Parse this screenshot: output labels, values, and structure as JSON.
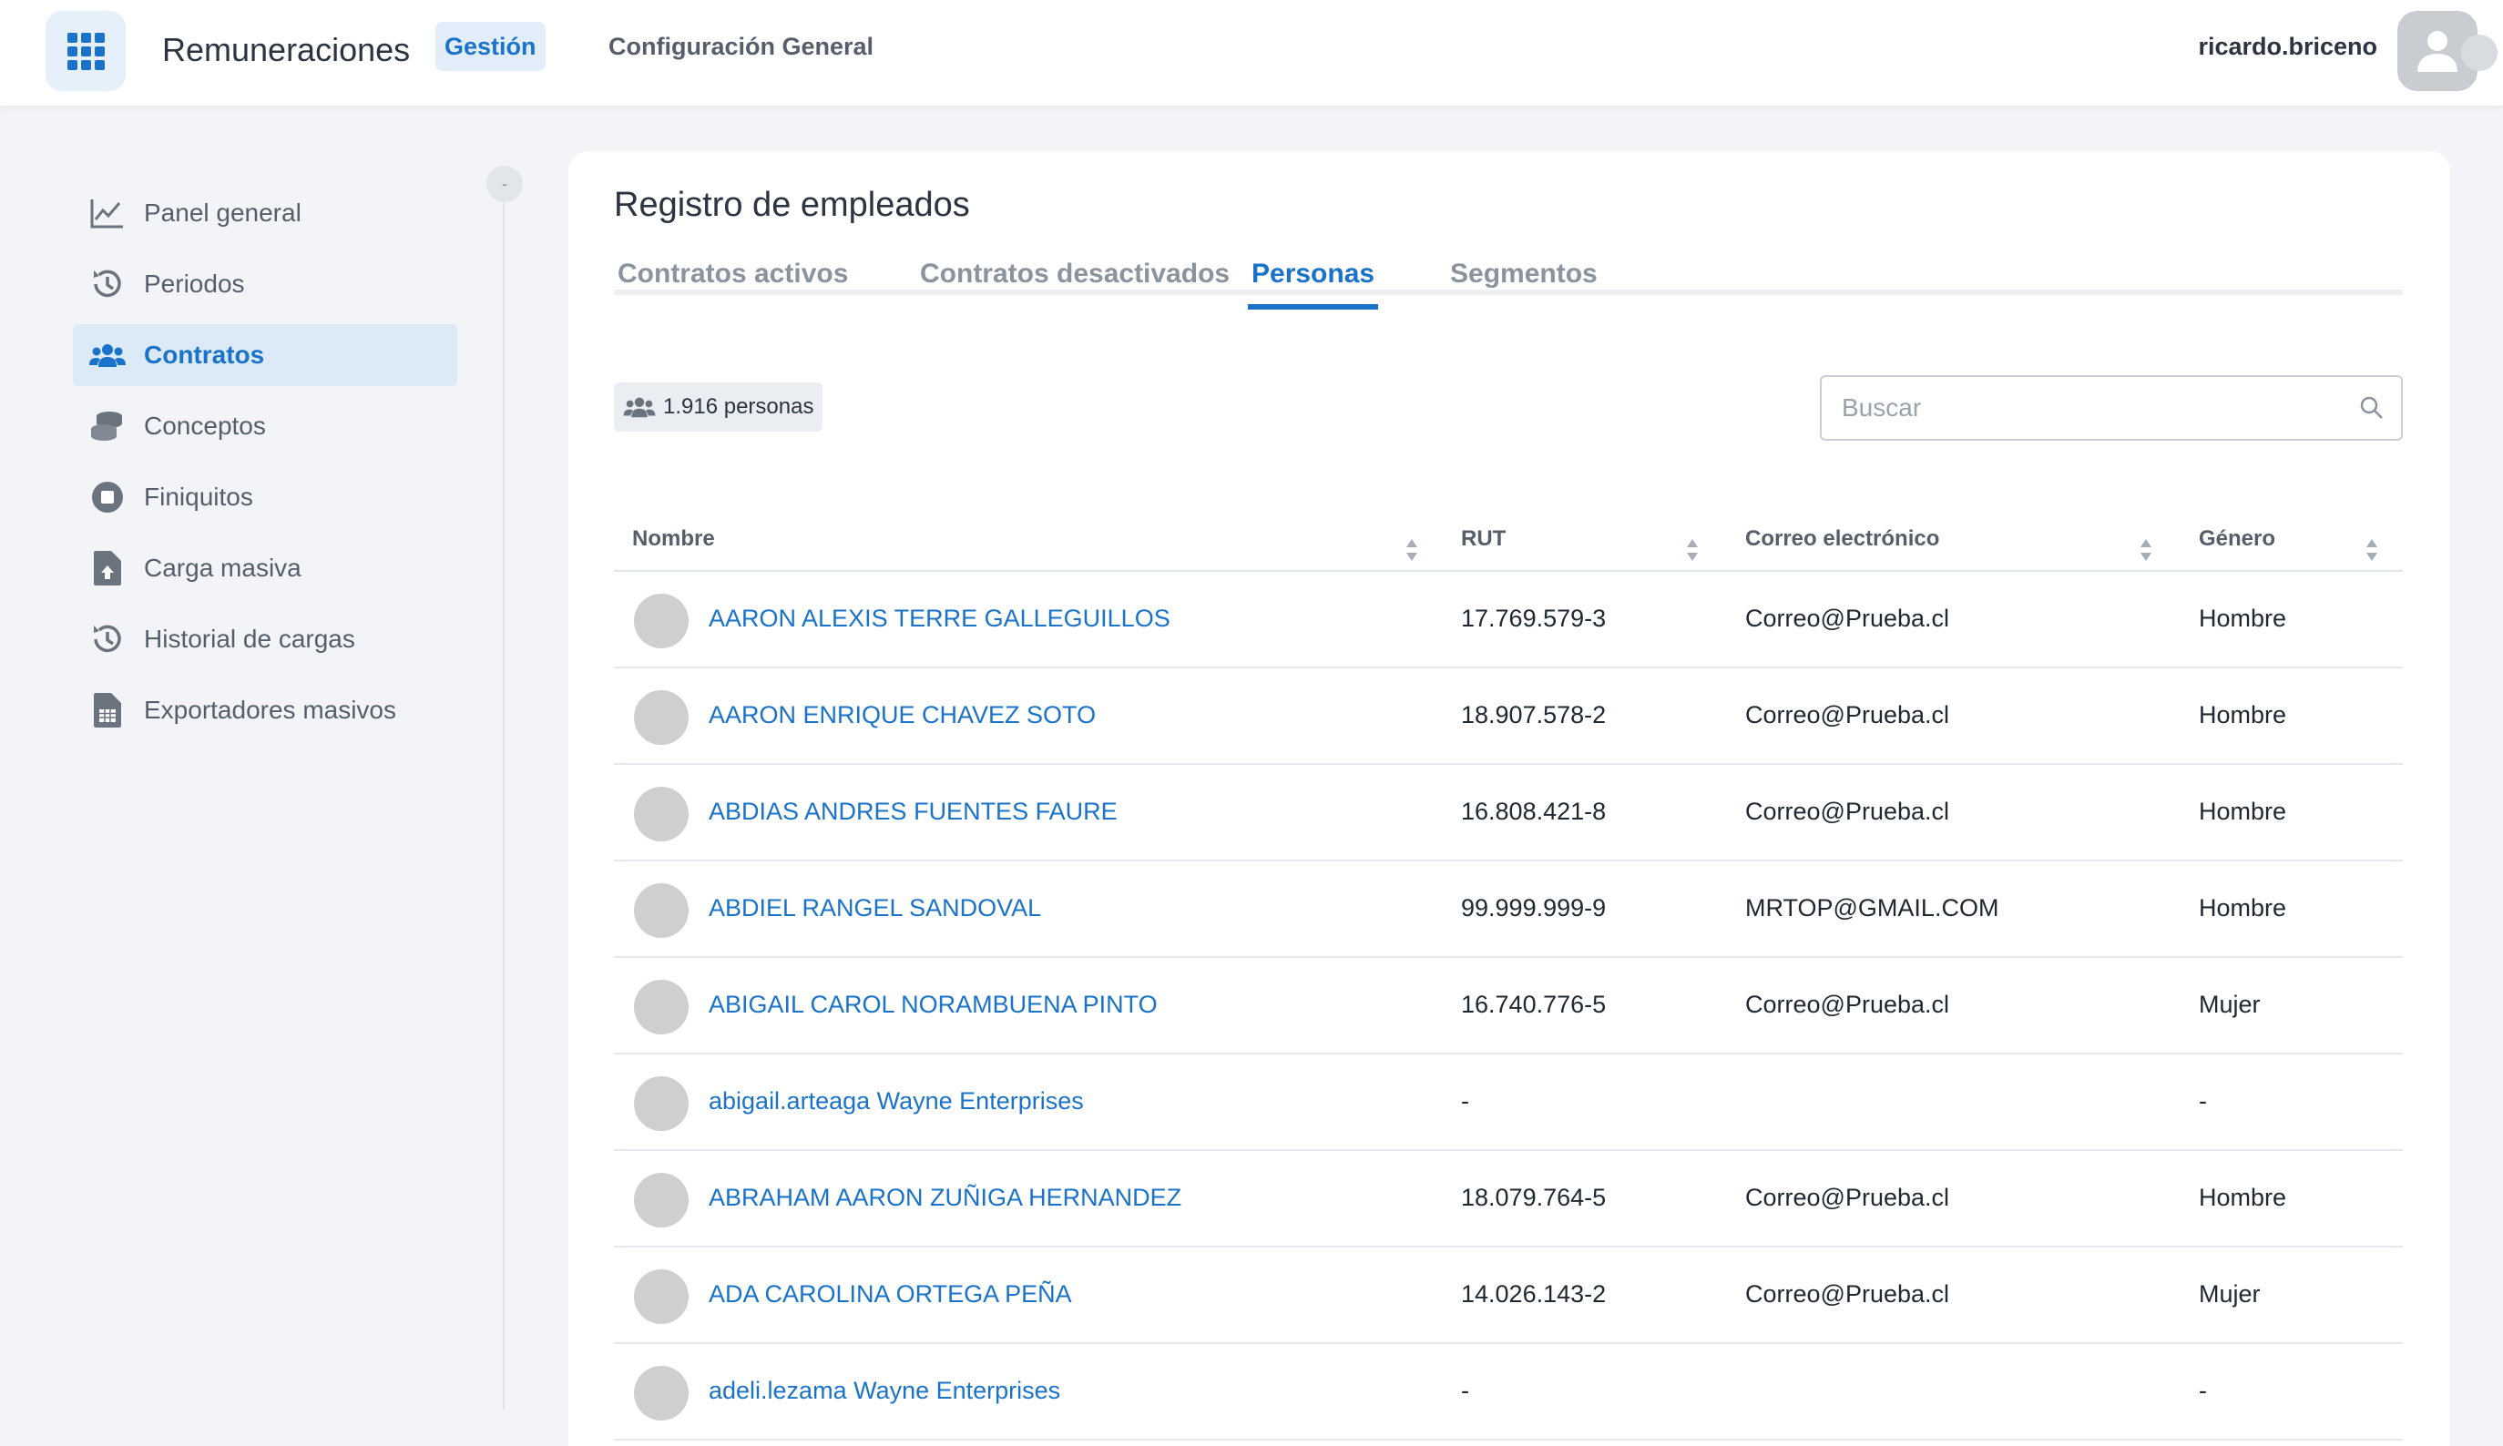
{
  "header": {
    "app_title": "Remuneraciones",
    "nav_gestion": "Gestión",
    "nav_config": "Configuración General",
    "username": "ricardo.briceno"
  },
  "sidebar": {
    "collapse": "-",
    "items": [
      {
        "label": "Panel general",
        "icon": "chart-line-icon"
      },
      {
        "label": "Periodos",
        "icon": "history-icon"
      },
      {
        "label": "Contratos",
        "icon": "users-icon",
        "active": true
      },
      {
        "label": "Conceptos",
        "icon": "coins-icon"
      },
      {
        "label": "Finiquitos",
        "icon": "stop-circle-icon"
      },
      {
        "label": "Carga masiva",
        "icon": "file-upload-icon"
      },
      {
        "label": "Historial de cargas",
        "icon": "history-icon"
      },
      {
        "label": "Exportadores masivos",
        "icon": "file-spreadsheet-icon"
      }
    ]
  },
  "main": {
    "title": "Registro de empleados",
    "tabs": [
      {
        "label": "Contratos activos"
      },
      {
        "label": "Contratos desactivados"
      },
      {
        "label": "Personas",
        "active": true
      },
      {
        "label": "Segmentos"
      }
    ],
    "count_label": "1.916 personas",
    "search_placeholder": "Buscar",
    "accent_color": "#1a73c9"
  },
  "table": {
    "columns": [
      "Nombre",
      "RUT",
      "Correo electrónico",
      "Género"
    ],
    "rows": [
      {
        "name": "AARON ALEXIS TERRE GALLEGUILLOS",
        "rut": "17.769.579-3",
        "email": "Correo@Prueba.cl",
        "gender": "Hombre"
      },
      {
        "name": "AARON ENRIQUE CHAVEZ SOTO",
        "rut": "18.907.578-2",
        "email": "Correo@Prueba.cl",
        "gender": "Hombre"
      },
      {
        "name": "ABDIAS ANDRES FUENTES FAURE",
        "rut": "16.808.421-8",
        "email": "Correo@Prueba.cl",
        "gender": "Hombre"
      },
      {
        "name": "ABDIEL RANGEL SANDOVAL",
        "rut": "99.999.999-9",
        "email": "MRTOP@GMAIL.COM",
        "gender": "Hombre"
      },
      {
        "name": "ABIGAIL CAROL NORAMBUENA PINTO",
        "rut": "16.740.776-5",
        "email": "Correo@Prueba.cl",
        "gender": "Mujer"
      },
      {
        "name": "abigail.arteaga Wayne Enterprises",
        "rut": "-",
        "email": "",
        "gender": "-"
      },
      {
        "name": "ABRAHAM AARON ZUÑIGA HERNANDEZ",
        "rut": "18.079.764-5",
        "email": "Correo@Prueba.cl",
        "gender": "Hombre"
      },
      {
        "name": "ADA CAROLINA ORTEGA PEÑA",
        "rut": "14.026.143-2",
        "email": "Correo@Prueba.cl",
        "gender": "Mujer"
      },
      {
        "name": "adeli.lezama Wayne Enterprises",
        "rut": "-",
        "email": "",
        "gender": "-"
      }
    ]
  }
}
